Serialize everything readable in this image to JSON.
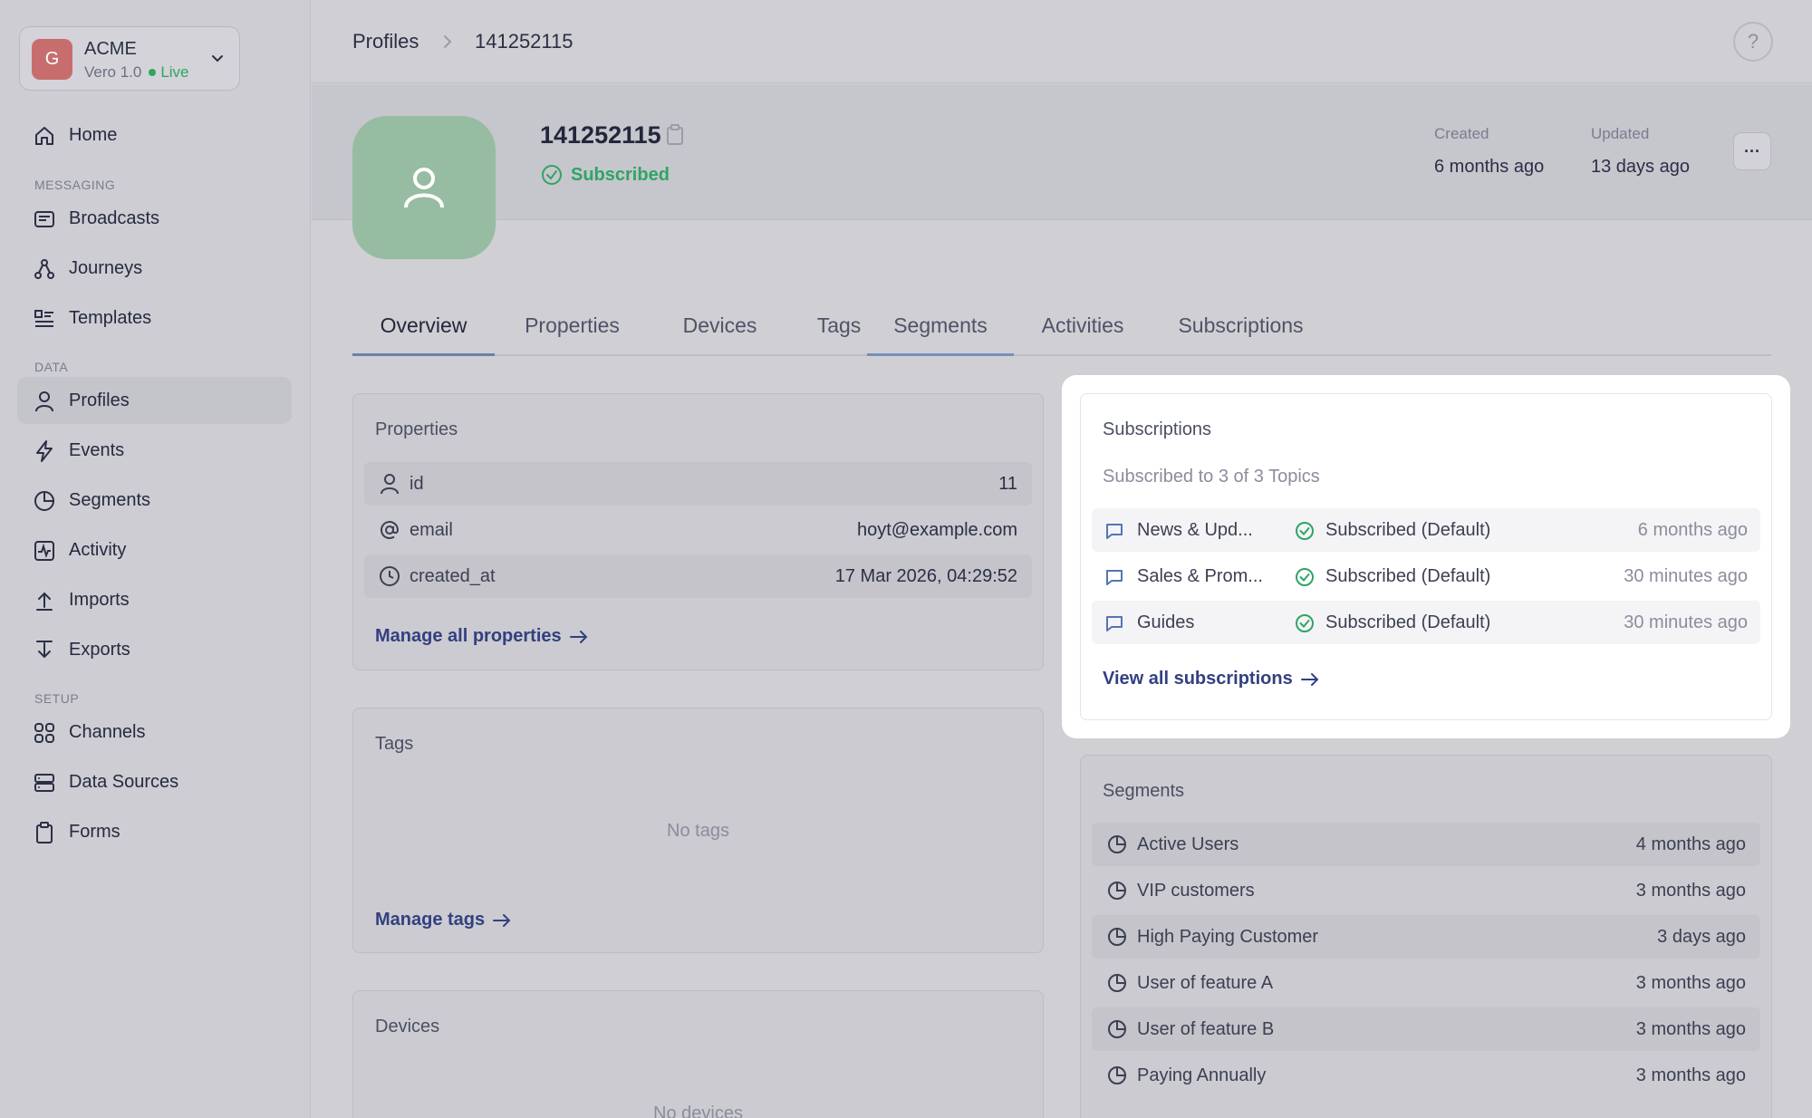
{
  "workspace": {
    "initial": "G",
    "name": "ACME",
    "version": "Vero 1.0",
    "status": "Live"
  },
  "nav": {
    "home": "Home",
    "messaging_label": "MESSAGING",
    "broadcasts": "Broadcasts",
    "journeys": "Journeys",
    "templates": "Templates",
    "data_label": "DATA",
    "profiles": "Profiles",
    "events": "Events",
    "segments": "Segments",
    "activity": "Activity",
    "imports": "Imports",
    "exports": "Exports",
    "setup_label": "SETUP",
    "channels": "Channels",
    "data_sources": "Data Sources",
    "forms": "Forms"
  },
  "breadcrumb": {
    "root": "Profiles",
    "current": "141252115"
  },
  "help": "?",
  "profile": {
    "id": "141252115",
    "status": "Subscribed",
    "created_label": "Created",
    "created_value": "6 months ago",
    "updated_label": "Updated",
    "updated_value": "13 days ago",
    "more": "···"
  },
  "tabs": [
    "Overview",
    "Properties",
    "Devices",
    "Tags",
    "Segments",
    "Activities",
    "Subscriptions"
  ],
  "properties_card": {
    "title": "Properties",
    "rows": [
      {
        "key": "id",
        "value": "11"
      },
      {
        "key": "email",
        "value": "hoyt@example.com"
      },
      {
        "key": "created_at",
        "value": "17 Mar 2026, 04:29:52"
      }
    ],
    "link": "Manage all properties"
  },
  "tags_card": {
    "title": "Tags",
    "empty": "No tags",
    "link": "Manage tags"
  },
  "devices_card": {
    "title": "Devices",
    "empty": "No devices"
  },
  "subscriptions_card": {
    "title": "Subscriptions",
    "summary": "Subscribed to 3 of 3 Topics",
    "rows": [
      {
        "name": "News & Upd...",
        "status": "Subscribed (Default)",
        "time": "6 months ago"
      },
      {
        "name": "Sales & Prom...",
        "status": "Subscribed (Default)",
        "time": "30 minutes ago"
      },
      {
        "name": "Guides",
        "status": "Subscribed (Default)",
        "time": "30 minutes ago"
      }
    ],
    "link": "View all subscriptions"
  },
  "segments_card": {
    "title": "Segments",
    "rows": [
      {
        "name": "Active Users",
        "time": "4 months ago"
      },
      {
        "name": "VIP customers",
        "time": "3 months ago"
      },
      {
        "name": "High Paying Customer",
        "time": "3 days ago"
      },
      {
        "name": "User of feature A",
        "time": "3 months ago"
      },
      {
        "name": "User of feature B",
        "time": "3 months ago"
      },
      {
        "name": "Paying Annually",
        "time": "3 months ago"
      }
    ]
  },
  "colors": {
    "accent": "#334080",
    "success": "#2fa463",
    "avatar_bg": "#96bca2",
    "workspace_avatar": "#c86d6d"
  }
}
